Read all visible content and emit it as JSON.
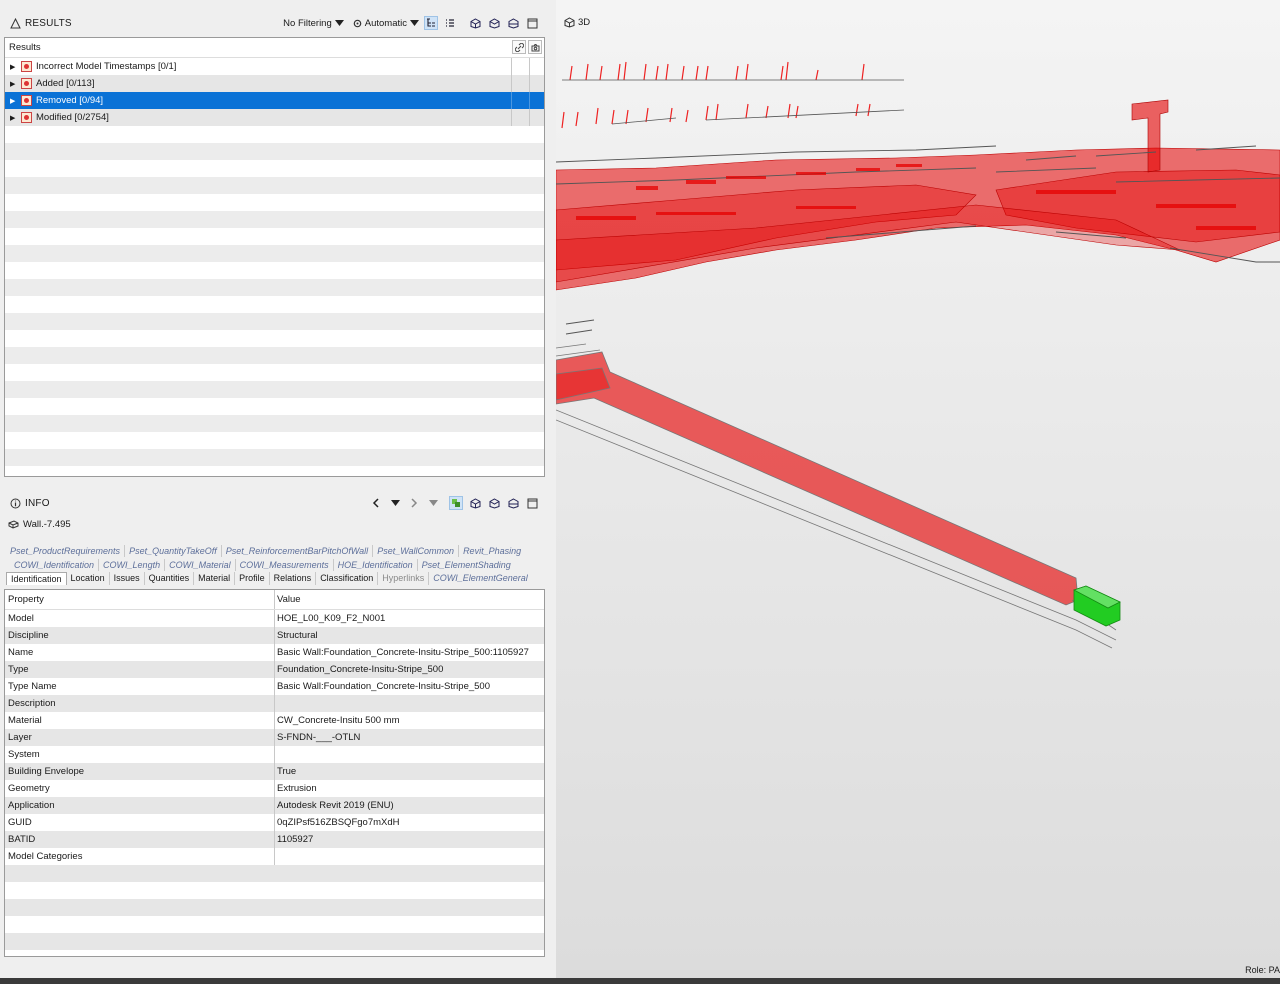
{
  "results": {
    "title": "RESULTS",
    "filter_label": "No Filtering",
    "mode_label": "Automatic",
    "tree_header": "Results",
    "items": [
      {
        "label": "Incorrect Model Timestamps [0/1]"
      },
      {
        "label": "Added [0/113]"
      },
      {
        "label": "Removed [0/94]"
      },
      {
        "label": "Modified [0/2754]"
      }
    ]
  },
  "info": {
    "title": "INFO",
    "object_name": "Wall.-7.495",
    "tabs_row1": [
      "Pset_ProductRequirements",
      "Pset_QuantityTakeOff",
      "Pset_ReinforcementBarPitchOfWall",
      "Pset_WallCommon",
      "Revit_Phasing"
    ],
    "tabs_row2": [
      "COWI_Identification",
      "COWI_Length",
      "COWI_Material",
      "COWI_Measurements",
      "HOE_Identification",
      "Pset_ElementShading"
    ],
    "tabs_row3": [
      "Identification",
      "Location",
      "Issues",
      "Quantities",
      "Material",
      "Profile",
      "Relations",
      "Classification",
      "Hyperlinks",
      "COWI_ElementGeneral"
    ],
    "active_tab": "Identification",
    "col_property": "Property",
    "col_value": "Value",
    "properties": [
      {
        "key": "Model",
        "value": "HOE_L00_K09_F2_N001"
      },
      {
        "key": "Discipline",
        "value": "Structural"
      },
      {
        "key": "Name",
        "value": "Basic Wall:Foundation_Concrete-Insitu-Stripe_500:1105927"
      },
      {
        "key": "Type",
        "value": "Foundation_Concrete-Insitu-Stripe_500"
      },
      {
        "key": "Type Name",
        "value": "Basic Wall:Foundation_Concrete-Insitu-Stripe_500"
      },
      {
        "key": "Description",
        "value": ""
      },
      {
        "key": "Material",
        "value": "CW_Concrete-Insitu 500 mm"
      },
      {
        "key": "Layer",
        "value": "S-FNDN-___-OTLN"
      },
      {
        "key": "System",
        "value": ""
      },
      {
        "key": "Building Envelope",
        "value": "True"
      },
      {
        "key": "Geometry",
        "value": "Extrusion"
      },
      {
        "key": "Application",
        "value": "Autodesk Revit 2019 (ENU)"
      },
      {
        "key": "GUID",
        "value": "0qZIPsf516ZBSQFgo7mXdH"
      },
      {
        "key": "BATID",
        "value": "1105927"
      },
      {
        "key": "Model Categories",
        "value": ""
      }
    ]
  },
  "view": {
    "label": "3D",
    "role_text": "Role: PA"
  },
  "colors": {
    "selection": "#0a72d6",
    "clash_red": "#e60000",
    "selected_green": "#22cc22"
  },
  "icons": [
    "warning-triangle-icon",
    "chevron-down-icon",
    "cube-icon",
    "info-circle-icon",
    "wall-icon",
    "link-icon",
    "camera-icon",
    "back-icon",
    "forward-icon"
  ]
}
